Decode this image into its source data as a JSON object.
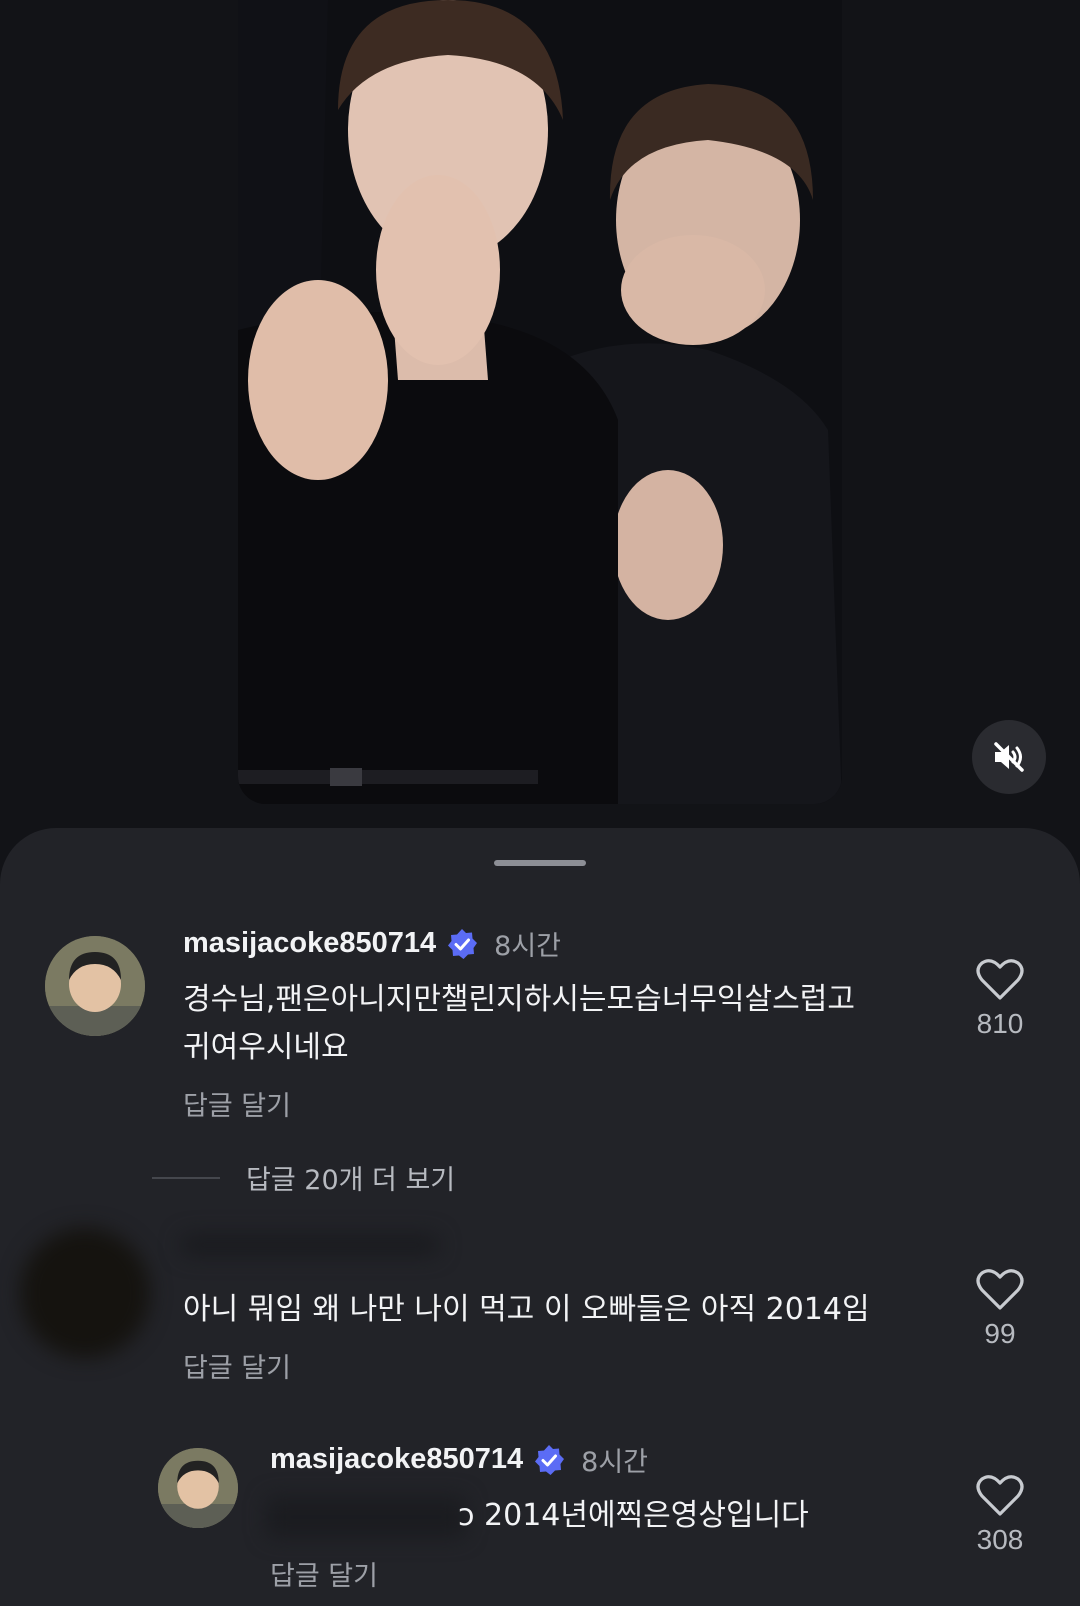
{
  "video": {
    "mute_icon": "speaker-muted-icon"
  },
  "comments": [
    {
      "username": "masijacoke850714",
      "verified": true,
      "time": "8시간",
      "text_lines": [
        "경수님,팬은아니지만챌린지하시는모습너무익살스럽고",
        "귀여우시네요"
      ],
      "reply_label": "답글 달기",
      "likes": "810"
    },
    {
      "text": "아니 뭐임 왜 나만 나이 먹고 이 오빠들은 아직 2014임",
      "reply_label": "답글 달기",
      "likes": "99"
    },
    {
      "username": "masijacoke850714",
      "verified": true,
      "time": "8시간",
      "text": "ↄ 2014년에찍은영상입니다",
      "reply_label": "답글 달기",
      "likes": "308"
    }
  ],
  "more_replies": "답글 20개 더 보기",
  "colors": {
    "background": "#121317",
    "sheet": "#222328",
    "verified_badge": "#5b6cf5",
    "secondary_text": "#9da0a7"
  }
}
